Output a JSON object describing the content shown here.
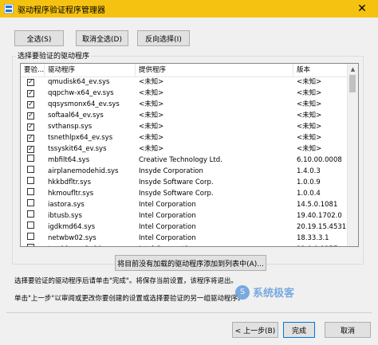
{
  "window": {
    "title": "驱动程序验证程序管理器",
    "close_icon": "✕",
    "accent": "#f5c211"
  },
  "top_buttons": {
    "select_all": "全选(S)",
    "deselect_all": "取消全选(D)",
    "invert": "反向选择(I)"
  },
  "group_label": "选择要验证的驱动程序",
  "columns": [
    "要验...",
    "驱动程序",
    "提供程序",
    "版本"
  ],
  "rows": [
    {
      "checked": true,
      "driver": "qmudisk64_ev.sys",
      "provider": "<未知>",
      "version": "<未知>"
    },
    {
      "checked": true,
      "driver": "qqpchw-x64_ev.sys",
      "provider": "<未知>",
      "version": "<未知>"
    },
    {
      "checked": true,
      "driver": "qqsysmonx64_ev.sys",
      "provider": "<未知>",
      "version": "<未知>"
    },
    {
      "checked": true,
      "driver": "softaal64_ev.sys",
      "provider": "<未知>",
      "version": "<未知>"
    },
    {
      "checked": true,
      "driver": "svthansp.sys",
      "provider": "<未知>",
      "version": "<未知>"
    },
    {
      "checked": true,
      "driver": "tsnethlpx64_ev.sys",
      "provider": "<未知>",
      "version": "<未知>"
    },
    {
      "checked": true,
      "driver": "tssyskit64_ev.sys",
      "provider": "<未知>",
      "version": "<未知>"
    },
    {
      "checked": false,
      "driver": "mbfilt64.sys",
      "provider": "Creative Technology Ltd.",
      "version": "6.10.00.0008"
    },
    {
      "checked": false,
      "driver": "airplanemodehid.sys",
      "provider": "Insyde Corporation",
      "version": "1.4.0.3"
    },
    {
      "checked": false,
      "driver": "hkkbdfltr.sys",
      "provider": "Insyde Software Corp.",
      "version": "1.0.0.9"
    },
    {
      "checked": false,
      "driver": "hkmoufltr.sys",
      "provider": "Insyde Software Corp.",
      "version": "1.0.0.4"
    },
    {
      "checked": false,
      "driver": "iastora.sys",
      "provider": "Intel Corporation",
      "version": "14.5.0.1081"
    },
    {
      "checked": false,
      "driver": "ibtusb.sys",
      "provider": "Intel Corporation",
      "version": "19.40.1702.0"
    },
    {
      "checked": false,
      "driver": "igdkmd64.sys",
      "provider": "Intel Corporation",
      "version": "20.19.15.4531"
    },
    {
      "checked": false,
      "driver": "netwbw02.sys",
      "provider": "Intel Corporation",
      "version": "18.33.3.1"
    },
    {
      "checked": false,
      "driver": "teedriverw8x64.sys",
      "provider": "Intel Corporation",
      "version": "11.0.0.1157"
    }
  ],
  "add_button": "将目前没有加载的驱动程序添加到列表中(A)...",
  "info_line1": "选择要验证的驱动程序后请单击\"完成\"。将保存当前设置，该程序将退出。",
  "info_line2": "单击\"上一步\"以审阅或更改你要创建的设置或选择要验证的另一组驱动程序。",
  "watermark": {
    "text": "系统极客",
    "logo": "S"
  },
  "bottom_buttons": {
    "back": "< 上一步(B)",
    "finish": "完成",
    "cancel": "取消"
  },
  "scroll_up": "▲",
  "check_mark": "✓"
}
